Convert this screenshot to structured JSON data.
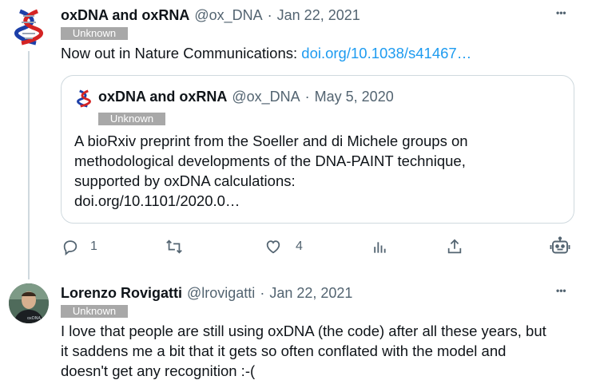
{
  "tweet1": {
    "author_name": "oxDNA and oxRNA",
    "handle": "@ox_DNA",
    "sep": "·",
    "date": "Jan 22, 2021",
    "badge": "Unknown",
    "text_prefix": "Now out in Nature Communications:",
    "link": "doi.org/10.1038/s41467…",
    "more": "•••",
    "quote": {
      "author_name": "oxDNA and oxRNA",
      "handle": "@ox_DNA",
      "sep": "·",
      "date": "May 5, 2020",
      "badge": "Unknown",
      "lines": [
        "A bioRxiv preprint from the Soeller and di Michele groups on",
        "methodological developments of the DNA-PAINT technique,",
        "supported by oxDNA calculations:",
        "doi.org/10.1101/2020.0…"
      ]
    },
    "actions": {
      "reply_count": "1",
      "retweet_count": "",
      "like_count": "4"
    }
  },
  "tweet2": {
    "author_name": "Lorenzo Rovigatti",
    "handle": "@lrovigatti",
    "sep": "·",
    "date": "Jan 22, 2021",
    "badge": "Unknown",
    "more": "•••",
    "lines": [
      "I love that people are still using oxDNA (the code) after all these years, but",
      "it saddens me a bit that it gets so often conflated with the model and",
      "doesn't get any recognition :-("
    ]
  },
  "colors": {
    "link": "#1d9bf0",
    "muted": "#536471",
    "badge": "#a8a8a8",
    "border": "#cfd9de"
  },
  "icons": [
    "dna-logo-icon",
    "reply-icon",
    "retweet-icon",
    "like-icon",
    "views-icon",
    "share-icon",
    "bot-icon",
    "more-icon"
  ]
}
